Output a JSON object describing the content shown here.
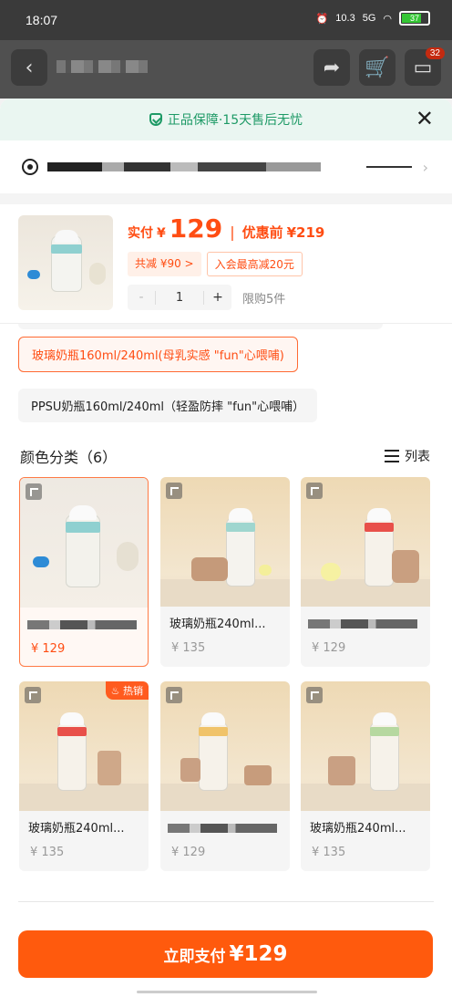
{
  "status_bar": {
    "time": "18:07",
    "speed": "10.3",
    "signal": "5G",
    "battery": "37"
  },
  "nav": {
    "message_badge": "32"
  },
  "sheet": {
    "guarantee_text": "正品保障·15天售后无忧"
  },
  "product": {
    "price_label": "实付",
    "currency": "¥",
    "price": "129",
    "separator": "|",
    "coupon_label": "优惠前",
    "coupon_price": "¥219",
    "discount_tag": "共减 ¥90 >",
    "member_tag": "入会最高减20元",
    "quantity": "1",
    "minus": "-",
    "plus": "+",
    "limit_text": "限购5件"
  },
  "specs": [
    {
      "label": "玻璃奶瓶160ml/240ml(母乳实感 \"fun\"心喂哺)",
      "selected": true
    },
    {
      "label": "PPSU奶瓶160ml/240ml（轻盈防摔 \"fun\"心喂哺）",
      "selected": false
    }
  ],
  "colors": {
    "title": "颜色分类（6）",
    "view_toggle": "列表",
    "items": [
      {
        "name": "",
        "price": "¥ 129",
        "selected": true,
        "hot": ""
      },
      {
        "name": "玻璃奶瓶240ml...",
        "price": "¥ 135",
        "selected": false,
        "hot": ""
      },
      {
        "name": "",
        "price": "¥ 129",
        "selected": false,
        "hot": ""
      },
      {
        "name": "玻璃奶瓶240ml...",
        "price": "¥ 135",
        "selected": false,
        "hot": "热销"
      },
      {
        "name": "",
        "price": "¥ 129",
        "selected": false,
        "hot": ""
      },
      {
        "name": "玻璃奶瓶240ml...",
        "price": "¥ 135",
        "selected": false,
        "hot": ""
      }
    ]
  },
  "pay_button": {
    "label": "立即支付",
    "amount": "¥129"
  }
}
